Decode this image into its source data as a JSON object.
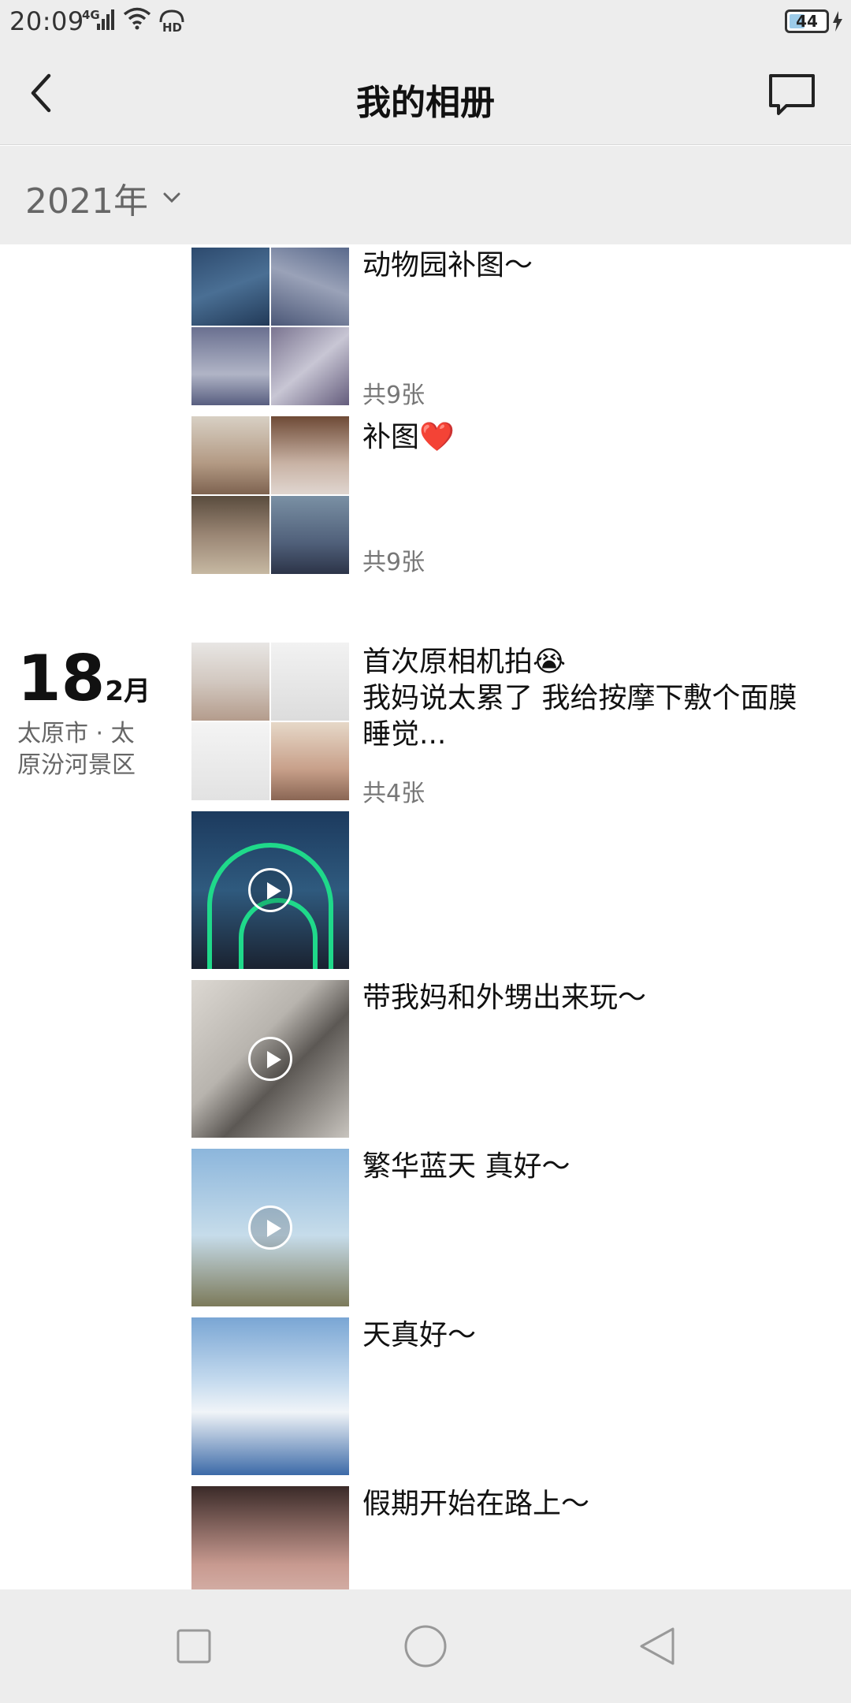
{
  "status_bar": {
    "time": "20:09",
    "network": "4G",
    "battery": "44",
    "battery_level": 0.44
  },
  "header": {
    "title": "我的相册",
    "back_icon": "chevron-left-icon",
    "message_icon": "speech-bubble-icon"
  },
  "year_filter": {
    "label": "2021年",
    "icon": "chevron-down-icon"
  },
  "entries": [
    {
      "text": "动物园补图～",
      "count": "共9张"
    },
    {
      "text": "补图❤️",
      "count": "共9张"
    },
    {
      "day": "18",
      "month": "2月",
      "location": "太原市 · 太原汾河景区",
      "text": "首次原相机拍😭\n我妈说太累了 我给按摩下敷个面膜睡觉...",
      "count": "共4张"
    },
    {
      "text": ""
    },
    {
      "text": "带我妈和外甥出来玩～"
    },
    {
      "text": "繁华蓝天 真好～"
    },
    {
      "text": "天真好～"
    },
    {
      "text": "假期开始在路上～"
    }
  ],
  "nav_bar": {
    "recent_icon": "square-icon",
    "home_icon": "circle-icon",
    "back_icon": "triangle-back-icon"
  },
  "colors": {
    "bar_background": "#ededed",
    "arch_green": "#1fd98a"
  }
}
